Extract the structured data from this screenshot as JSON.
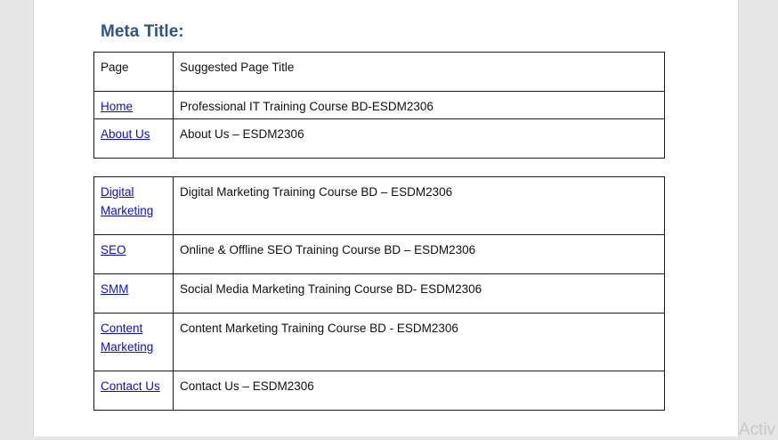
{
  "heading": "Meta Title:",
  "table_top": {
    "header": {
      "page": "Page",
      "title": "Suggested Page Title"
    },
    "rows": [
      {
        "page": "Home",
        "title": "Professional IT Training Course BD-ESDM2306"
      },
      {
        "page": "About Us",
        "title": "About Us – ESDM2306"
      }
    ]
  },
  "table_bottom": {
    "rows": [
      {
        "page_line1": "Digital",
        "page_line2": "Marketing",
        "title": "Digital Marketing Training Course BD – ESDM2306"
      },
      {
        "page": "SEO",
        "title": "Online & Offline SEO Training Course BD – ESDM2306"
      },
      {
        "page": "SMM",
        "title": "Social Media Marketing Training Course BD- ESDM2306"
      },
      {
        "page_line1": "Content",
        "page_line2": "Marketing",
        "title": "Content Marketing Training Course BD - ESDM2306"
      },
      {
        "page": "Contact Us",
        "title": "Contact Us – ESDM2306"
      }
    ]
  },
  "watermark": "Activ",
  "colors": {
    "heading": "#2e5486",
    "link": "#0d0dd8",
    "border": "#1a1a1a",
    "background": "#e6e6e6"
  }
}
